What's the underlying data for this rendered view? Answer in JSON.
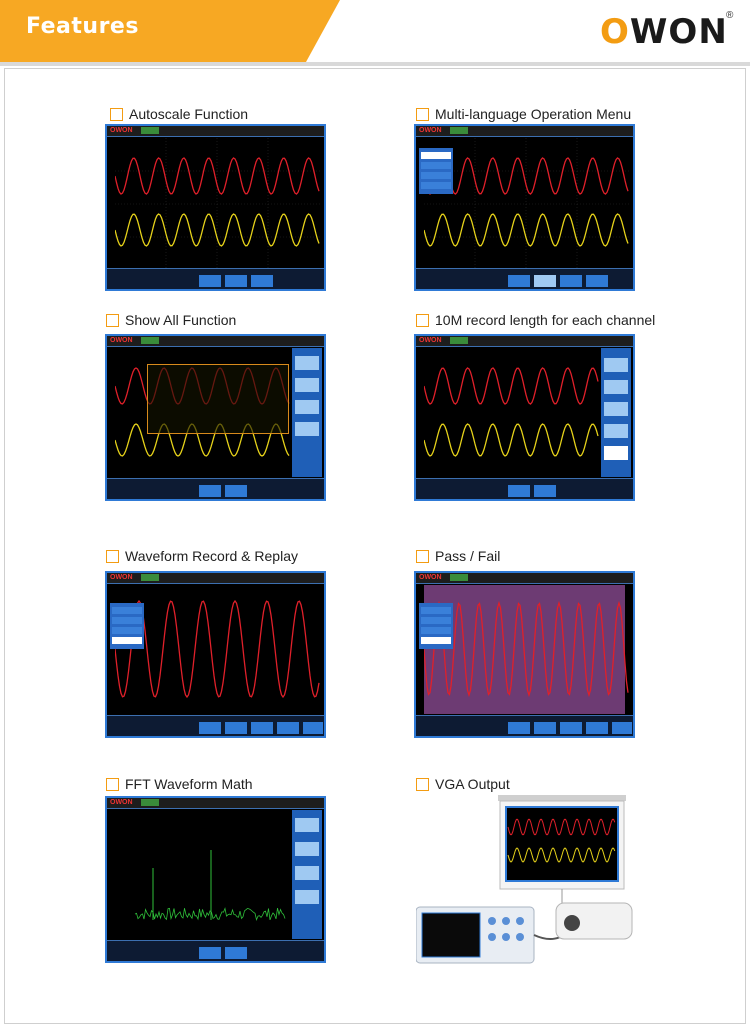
{
  "header": {
    "title": "Features",
    "logo": "OWON"
  },
  "features": [
    {
      "title": "Autoscale Function"
    },
    {
      "title": "Multi-language Operation Menu"
    },
    {
      "title": "Show  All  Function"
    },
    {
      "title": "10M record length for each channel"
    },
    {
      "title": "Waveform Record & Replay"
    },
    {
      "title": "Pass / Fail"
    },
    {
      "title": "FFT Waveform Math"
    },
    {
      "title": "VGA Output"
    }
  ],
  "colors": {
    "accent": "#f7a823",
    "checkbox": "#f39c12",
    "scope_frame": "#2f7ad6",
    "ch1_wave": "#e0202a",
    "ch2_wave": "#e6d21a"
  }
}
